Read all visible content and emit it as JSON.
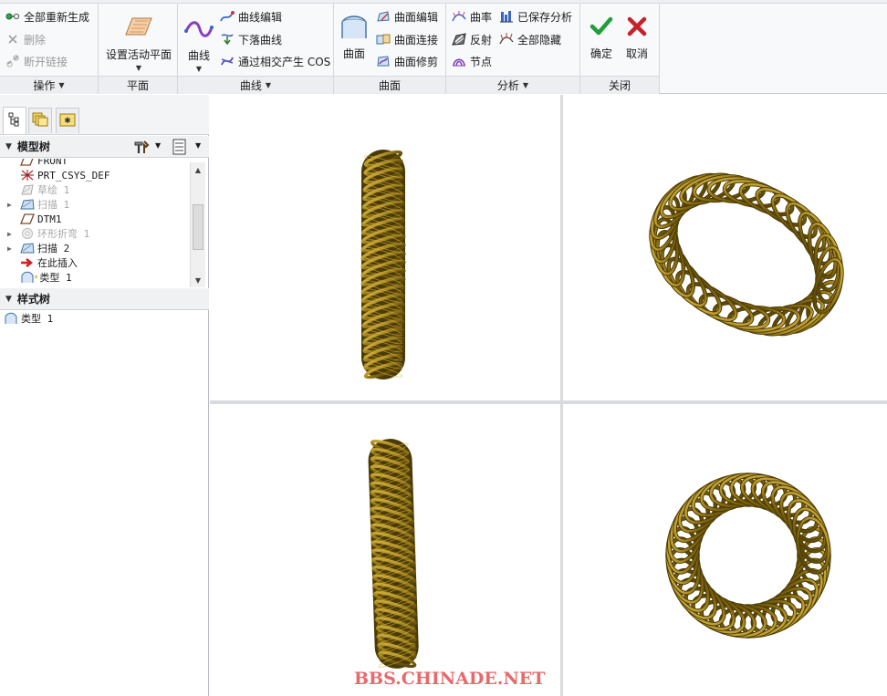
{
  "ribbon": {
    "operations": {
      "regenerate_all": "全部重新生成",
      "delete": "删除",
      "break_link": "断开链接",
      "footer": "操作"
    },
    "plane": {
      "set_active_plane": "设置活动平面",
      "footer": "平面"
    },
    "curve": {
      "curve": "曲线",
      "curve_edit": "曲线编辑",
      "drop_curve": "下落曲线",
      "cos": "通过相交产生 COS",
      "footer": "曲线"
    },
    "surface": {
      "surface": "曲面",
      "surface_edit": "曲面编辑",
      "surface_connect": "曲面连接",
      "surface_trim": "曲面修剪",
      "footer": "曲面"
    },
    "analysis": {
      "curvature": "曲率",
      "saved_analysis": "已保存分析",
      "reflection": "反射",
      "hide_all": "全部隐藏",
      "node": "节点",
      "footer": "分析"
    },
    "close": {
      "ok": "确定",
      "cancel": "取消",
      "footer": "关闭"
    }
  },
  "model_tree": {
    "title": "模型树",
    "items": [
      {
        "label": "FRONT",
        "icon": "datum-plane-icon",
        "dim": false,
        "expand": ""
      },
      {
        "label": "PRT_CSYS_DEF",
        "icon": "csys-icon",
        "dim": false,
        "expand": ""
      },
      {
        "label": "草绘 1",
        "icon": "sketch-icon",
        "dim": true,
        "expand": ""
      },
      {
        "label": "扫描 1",
        "icon": "sweep-icon",
        "dim": true,
        "expand": "▶"
      },
      {
        "label": "DTM1",
        "icon": "datum-plane-icon",
        "dim": false,
        "expand": ""
      },
      {
        "label": "环形折弯 1",
        "icon": "toroidal-bend-icon",
        "dim": true,
        "expand": "▶"
      },
      {
        "label": "扫描 2",
        "icon": "sweep-icon",
        "dim": false,
        "expand": "▶"
      },
      {
        "label": "在此插入",
        "icon": "insert-here-arrow-icon",
        "dim": false,
        "expand": ""
      },
      {
        "label": "类型 1",
        "icon": "style-feature-icon",
        "dim": false,
        "expand": ""
      }
    ]
  },
  "style_tree": {
    "title": "样式树",
    "items": [
      {
        "label": "类型 1",
        "icon": "style-feature-icon"
      }
    ]
  },
  "watermark": "BBS.CHINADE.NET",
  "colors": {
    "coil_dark": "#4a3a05",
    "coil_mid": "#8a6d12",
    "coil_light": "#d8b640",
    "ok_green": "#1f9e3a",
    "cancel_red": "#c8202a",
    "watermark": "#e8696b"
  }
}
